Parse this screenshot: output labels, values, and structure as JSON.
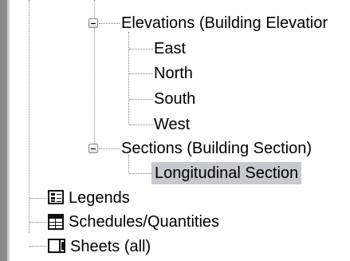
{
  "tree": {
    "elevations_label": "Elevations (Building Elevatior",
    "elevation_items": [
      "East",
      "North",
      "South",
      "West"
    ],
    "sections_label": "Sections (Building Section)",
    "section_items": [
      "Longitudinal Section"
    ],
    "legends_label": "Legends",
    "schedules_label": "Schedules/Quantities",
    "sheets_label": "Sheets (all)",
    "icons": {
      "legends": "legend-icon",
      "schedules": "schedule-icon",
      "sheets": "sheet-icon"
    },
    "selected_color": "#c8c8d0"
  }
}
